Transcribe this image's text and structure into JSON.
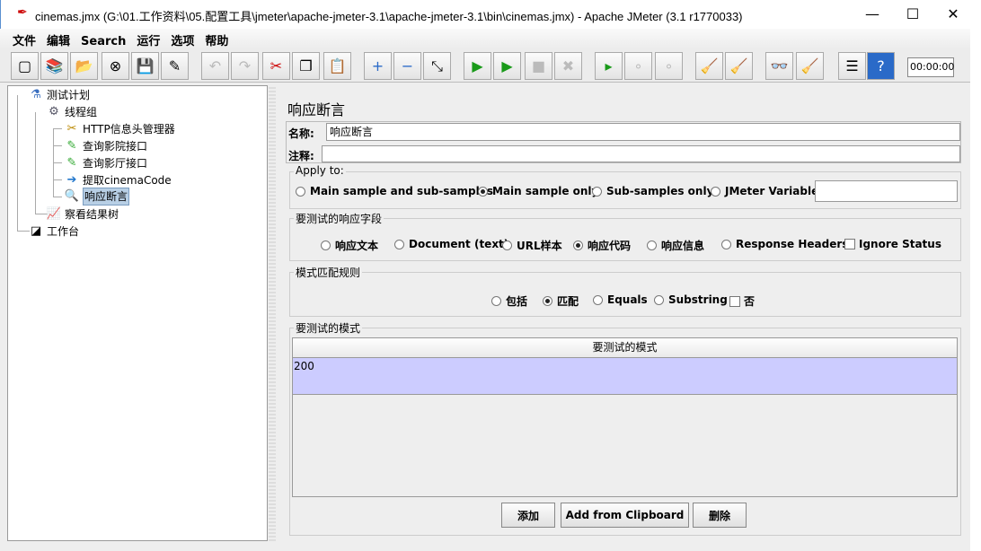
{
  "window": {
    "title": "cinemas.jmx (G:\\01.工作资料\\05.配置工具\\jmeter\\apache-jmeter-3.1\\apache-jmeter-3.1\\bin\\cinemas.jmx) - Apache JMeter (3.1 r1770033)",
    "minimize": "—",
    "maximize": "☐",
    "close": "✕"
  },
  "menu": [
    "文件",
    "编辑",
    "Search",
    "运行",
    "选项",
    "帮助"
  ],
  "toolbar": {
    "timer": "00:00:00",
    "icons": [
      "new-icon",
      "templates-icon",
      "open-icon",
      "close-file-icon",
      "save-icon",
      "save-as-icon",
      "undo-icon",
      "redo-icon",
      "cut-icon",
      "copy-icon",
      "paste-icon",
      "expand-icon",
      "collapse-icon",
      "toggle-icon",
      "start-icon",
      "start-no-pause-icon",
      "stop-icon",
      "shutdown-icon",
      "remote-start-icon",
      "remote-stop-icon",
      "remote-shutdown-icon",
      "clear-icon",
      "clear-all-icon",
      "search-icon",
      "reset-search-icon",
      "function-helper-icon",
      "help-icon"
    ]
  },
  "tree": {
    "items": [
      "测试计划",
      "线程组",
      "HTTP信息头管理器",
      "查询影院接口",
      "查询影厅接口",
      "提取cinemaCode",
      "响应断言",
      "察看结果树",
      "工作台"
    ],
    "selected": "响应断言"
  },
  "panel": {
    "title": "响应断言",
    "name_label": "名称:",
    "name_value": "响应断言",
    "comment_label": "注释:",
    "comment_value": "",
    "apply_to": {
      "title": "Apply to:",
      "options": [
        "Main sample and sub-samples",
        "Main sample only",
        "Sub-samples only",
        "JMeter Variable"
      ],
      "selected": "Main sample only",
      "variable_value": ""
    },
    "field": {
      "title": "要测试的响应字段",
      "options": [
        "响应文本",
        "Document (text)",
        "URL样本",
        "响应代码",
        "响应信息",
        "Response Headers"
      ],
      "selected": "响应代码",
      "ignore_status": "Ignore Status",
      "ignore_checked": false
    },
    "rule": {
      "title": "模式匹配规则",
      "options": [
        "包括",
        "匹配",
        "Equals",
        "Substring"
      ],
      "selected": "匹配",
      "not_label": "否",
      "not_checked": false
    },
    "patterns": {
      "title": "要测试的模式",
      "column": "要测试的模式",
      "rows": [
        "200"
      ]
    },
    "buttons": {
      "add": "添加",
      "add_clipboard": "Add from Clipboard",
      "delete": "删除"
    }
  }
}
